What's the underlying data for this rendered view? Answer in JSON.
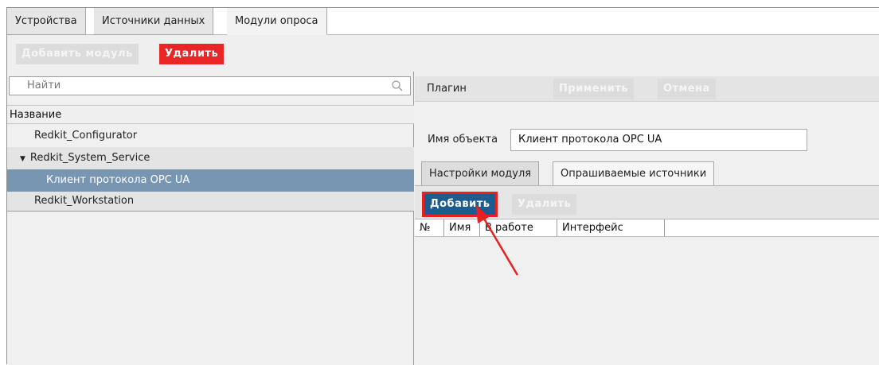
{
  "tabs": [
    "Устройства",
    "Источники данных",
    "Модули опроса"
  ],
  "toolbar": {
    "add_module": "Добавить модуль",
    "delete": "Удалить"
  },
  "search": {
    "placeholder": "Найти"
  },
  "tree": {
    "header": "Название",
    "items": [
      {
        "label": "Redkit_Configurator"
      },
      {
        "label": "Redkit_System_Service",
        "expander": "▼"
      },
      {
        "label": "Клиент протокола OPC UA"
      },
      {
        "label": "Redkit_Workstation"
      }
    ]
  },
  "plugin": {
    "label": "Плагин",
    "apply": "Применить",
    "cancel": "Отмена"
  },
  "object": {
    "label": "Имя объекта",
    "value": "Клиент протокола OPC UA"
  },
  "subtabs": [
    "Настройки модуля",
    "Опрашиваемые источники"
  ],
  "subtoolbar": {
    "add": "Добавить",
    "delete": "Удалить"
  },
  "grid": {
    "columns": [
      "№",
      "Имя",
      "В работе",
      "Интерфейс"
    ]
  },
  "colors": {
    "accent_red": "#ea2525",
    "accent_blue": "#1c5d8e",
    "selection": "#7896b2",
    "annotation": "#e8201f"
  }
}
